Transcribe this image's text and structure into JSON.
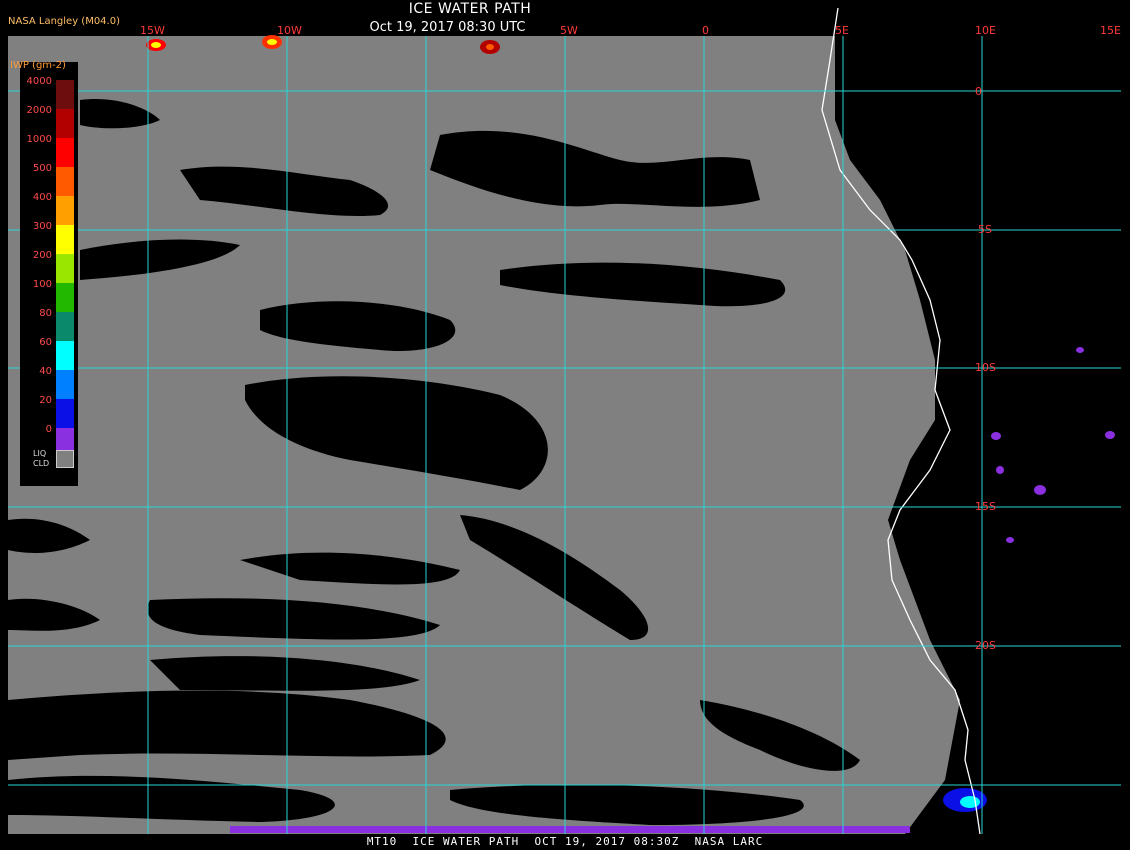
{
  "header": {
    "source": "NASA Langley (M04.0)",
    "title": "ICE WATER PATH",
    "datetime": "Oct 19, 2017 08:30 UTC"
  },
  "footer": {
    "text": "MT10  ICE WATER PATH  OCT 19, 2017 08:30Z  NASA LARC"
  },
  "colors": {
    "grid": "#2ad4d4",
    "liquid_cloud": "#808080",
    "clear": "#000000",
    "coastline": "#ffffff",
    "label": "#ff3a3a"
  },
  "longitude_labels": [
    "15W",
    "10W",
    "5W",
    "0",
    "5E",
    "10E",
    "15E"
  ],
  "latitude_labels": [
    "0",
    "5S",
    "10S",
    "15S",
    "20S"
  ],
  "legend": {
    "title": "IWP (gm-2)",
    "ticks": [
      "4000",
      "2000",
      "1000",
      "500",
      "400",
      "300",
      "200",
      "100",
      "80",
      "60",
      "40",
      "20",
      "0"
    ],
    "colors": [
      "#6e0d0d",
      "#b20000",
      "#ff0000",
      "#ff5a00",
      "#ff9f00",
      "#ffff00",
      "#9ae600",
      "#22b800",
      "#0a8a6a",
      "#00ffff",
      "#0080ff",
      "#0a10e6",
      "#8a30e0"
    ],
    "liquid_label_1": "LIQ",
    "liquid_label_2": "CLD"
  }
}
